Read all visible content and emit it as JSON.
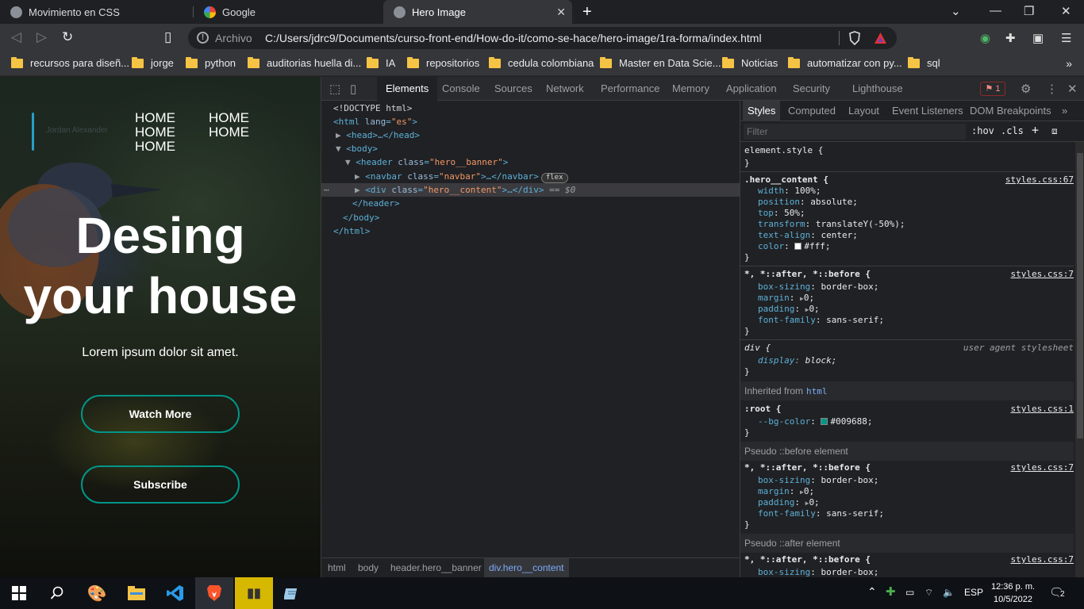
{
  "tabs": [
    {
      "title": "Movimiento en CSS"
    },
    {
      "title": "Google"
    },
    {
      "title": "Hero Image"
    }
  ],
  "toolbar": {
    "security_label": "Archivo",
    "url": "C:/Users/jdrc9/Documents/curso-front-end/How-do-it/como-se-hace/hero-image/1ra-forma/index.html"
  },
  "bookmarks": [
    "recursos para diseñ...",
    "jorge",
    "python",
    "auditorias huella di...",
    "IA",
    "repositorios",
    "cedula colombiana",
    "Master en Data Scie...",
    "Noticias",
    "automatizar con py...",
    "sql"
  ],
  "page": {
    "logo_text": "Jordan Alexander",
    "nav_links": [
      "HOME",
      "HOME",
      "HOME",
      "HOME",
      "HOME"
    ],
    "hero_title_line1": "Desing",
    "hero_title_line2": "your house",
    "hero_subtitle": "Lorem ipsum dolor sit amet.",
    "btn_watch": "Watch More",
    "btn_subscribe": "Subscribe",
    "accent_color": "#009688"
  },
  "devtools": {
    "tabs": [
      "Elements",
      "Console",
      "Sources",
      "Network",
      "Performance",
      "Memory",
      "Application",
      "Security",
      "Lighthouse"
    ],
    "issues_count": "1",
    "dom": {
      "doctype": "<!DOCTYPE html>",
      "html_open_tag": "<html",
      "html_attr": "lang",
      "html_val": "\"es\"",
      "head": "<head>…</head>",
      "body_open": "<body>",
      "header_tag": "<header",
      "header_attr": "class",
      "header_val": "\"hero__banner\"",
      "navbar_tag": "<navbar",
      "navbar_attr": "class",
      "navbar_val": "\"navbar\"",
      "navbar_end": ">…</navbar>",
      "flex_badge": "flex",
      "div_tag": "<div",
      "div_attr": "class",
      "div_val": "\"hero__content\"",
      "div_end": ">…</div>",
      "selected_marker": "== $0",
      "header_close": "</header>",
      "body_close": "</body>",
      "html_close": "</html>"
    },
    "breadcrumbs": [
      "html",
      "body",
      "header.hero__banner",
      "div.hero__content"
    ],
    "styles_tabs": [
      "Styles",
      "Computed",
      "Layout",
      "Event Listeners",
      "DOM Breakpoints"
    ],
    "filter_placeholder": "Filter",
    "hov": ":hov",
    "cls": ".cls",
    "rules": {
      "element_style": "element.style {",
      "close": "}",
      "hero_selector": ".hero__content {",
      "hero_src": "styles.css:67",
      "hero_props": [
        {
          "p": "width",
          "v": "100%;"
        },
        {
          "p": "position",
          "v": "absolute;"
        },
        {
          "p": "top",
          "v": "50%;"
        },
        {
          "p": "transform",
          "v": "translateY(-50%);"
        },
        {
          "p": "text-align",
          "v": "center;"
        },
        {
          "p": "color",
          "v": "#fff;"
        }
      ],
      "univ_selector": "*, *::after, *::before {",
      "univ_src": "styles.css:7",
      "univ_props": [
        {
          "p": "box-sizing",
          "v": "border-box;"
        },
        {
          "p": "margin",
          "v": "0;"
        },
        {
          "p": "padding",
          "v": "0;"
        },
        {
          "p": "font-family",
          "v": "sans-serif;"
        }
      ],
      "div_selector": "div {",
      "div_src": "user agent stylesheet",
      "div_props": [
        {
          "p": "display",
          "v": "block;"
        }
      ],
      "inherited_label": "Inherited from",
      "inherited_link": "html",
      "root_selector": ":root {",
      "root_src": "styles.css:1",
      "root_props": [
        {
          "p": "--bg-color",
          "v": "#009688;"
        }
      ],
      "pseudo_before": "Pseudo ::before element",
      "pseudo_after": "Pseudo ::after element",
      "last_prop": {
        "p": "box-sizing",
        "v": "border-box;"
      }
    }
  },
  "taskbar": {
    "lang": "ESP",
    "time": "12:36 p. m.",
    "date": "10/5/2022",
    "notif_count": "2"
  }
}
